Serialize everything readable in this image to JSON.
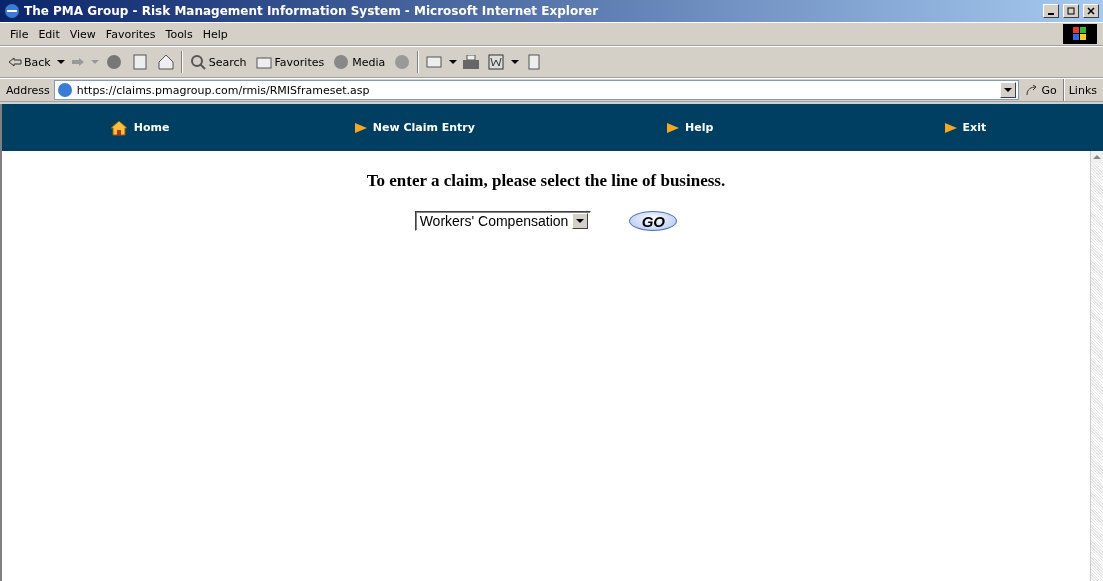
{
  "window": {
    "title": "The PMA Group - Risk Management Information System - Microsoft Internet Explorer"
  },
  "menu": [
    "File",
    "Edit",
    "View",
    "Favorites",
    "Tools",
    "Help"
  ],
  "toolbar": {
    "back": "Back",
    "search": "Search",
    "favorites": "Favorites",
    "media": "Media"
  },
  "address": {
    "label": "Address",
    "url": "https://claims.pmagroup.com/rmis/RMISframeset.asp",
    "go": "Go",
    "links": "Links"
  },
  "nav": [
    {
      "kind": "home",
      "label": "Home"
    },
    {
      "kind": "arrow",
      "label": "New Claim Entry"
    },
    {
      "kind": "arrow",
      "label": "Help"
    },
    {
      "kind": "arrow",
      "label": "Exit"
    }
  ],
  "content": {
    "heading": "To enter a claim, please select the line of business.",
    "select": "Workers' Compensation",
    "button": "GO"
  }
}
